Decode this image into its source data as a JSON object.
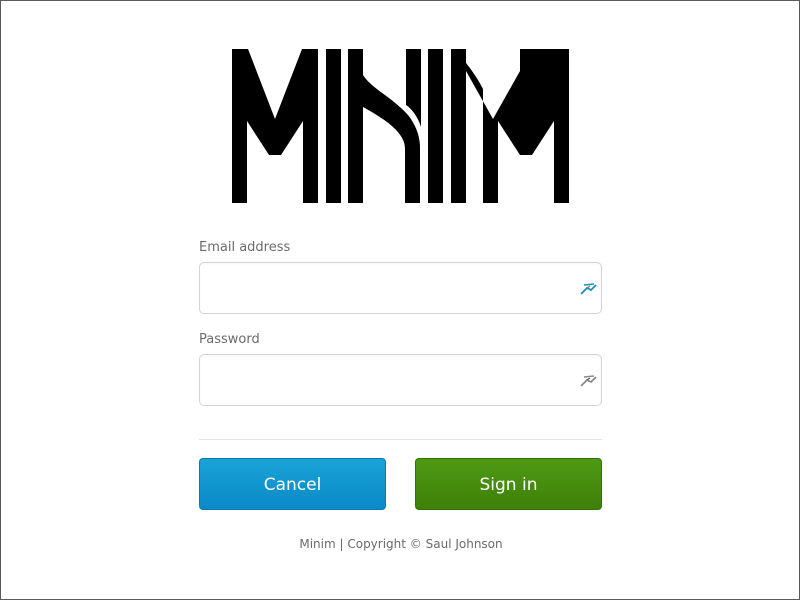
{
  "logo": {
    "text": "MINIM",
    "color": "#000000"
  },
  "form": {
    "email": {
      "label": "Email address",
      "value": "",
      "placeholder": "",
      "icon": "password-manager-icon",
      "icon_color": "#1d8fb3"
    },
    "password": {
      "label": "Password",
      "value": "",
      "placeholder": "",
      "icon": "password-manager-icon",
      "icon_color": "#8a8a8a"
    }
  },
  "buttons": {
    "cancel_label": "Cancel",
    "cancel_color": "#1297cf",
    "signin_label": "Sign in",
    "signin_color": "#468d0e"
  },
  "footer": {
    "text": "Minim | Copyright © Saul Johnson"
  }
}
